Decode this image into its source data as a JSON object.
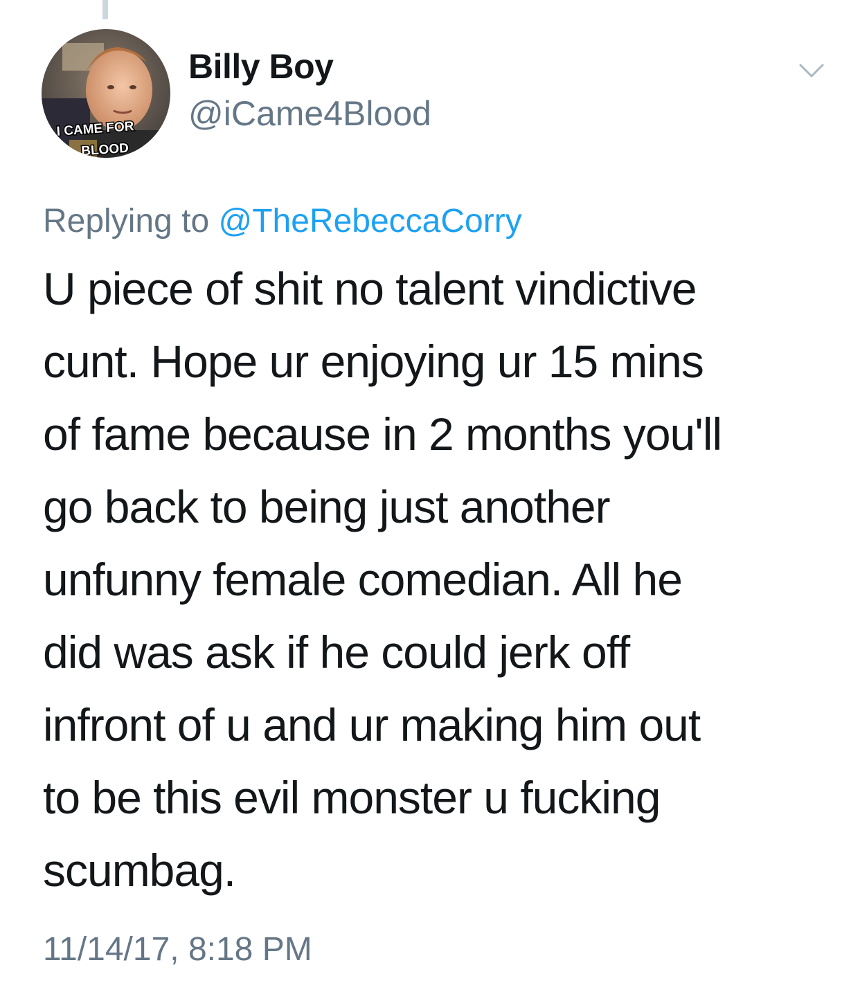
{
  "tweet": {
    "display_name": "Billy Boy",
    "handle": "@iCame4Blood",
    "avatar_caption_line1": "I CAME FOR",
    "avatar_caption_line2": "BLOOD",
    "replying_prefix": "Replying to ",
    "replying_to": "@TheRebeccaCorry",
    "text": "U piece of shit no talent vindictive\ncunt. Hope ur enjoying ur 15 mins\nof fame because in 2 months you'll\ngo back to being just another\nunfunny female comedian. All he\ndid was ask if he could jerk off\ninfront of u and ur making him out\nto be this evil monster u fucking\nscumbag.",
    "timestamp": "11/14/17, 8:18 PM"
  },
  "icons": {
    "more_menu": "chevron-down-icon"
  },
  "colors": {
    "text_primary": "#14171a",
    "text_secondary": "#657786",
    "link": "#1da1f2",
    "thread_line": "#ccd6dd"
  }
}
